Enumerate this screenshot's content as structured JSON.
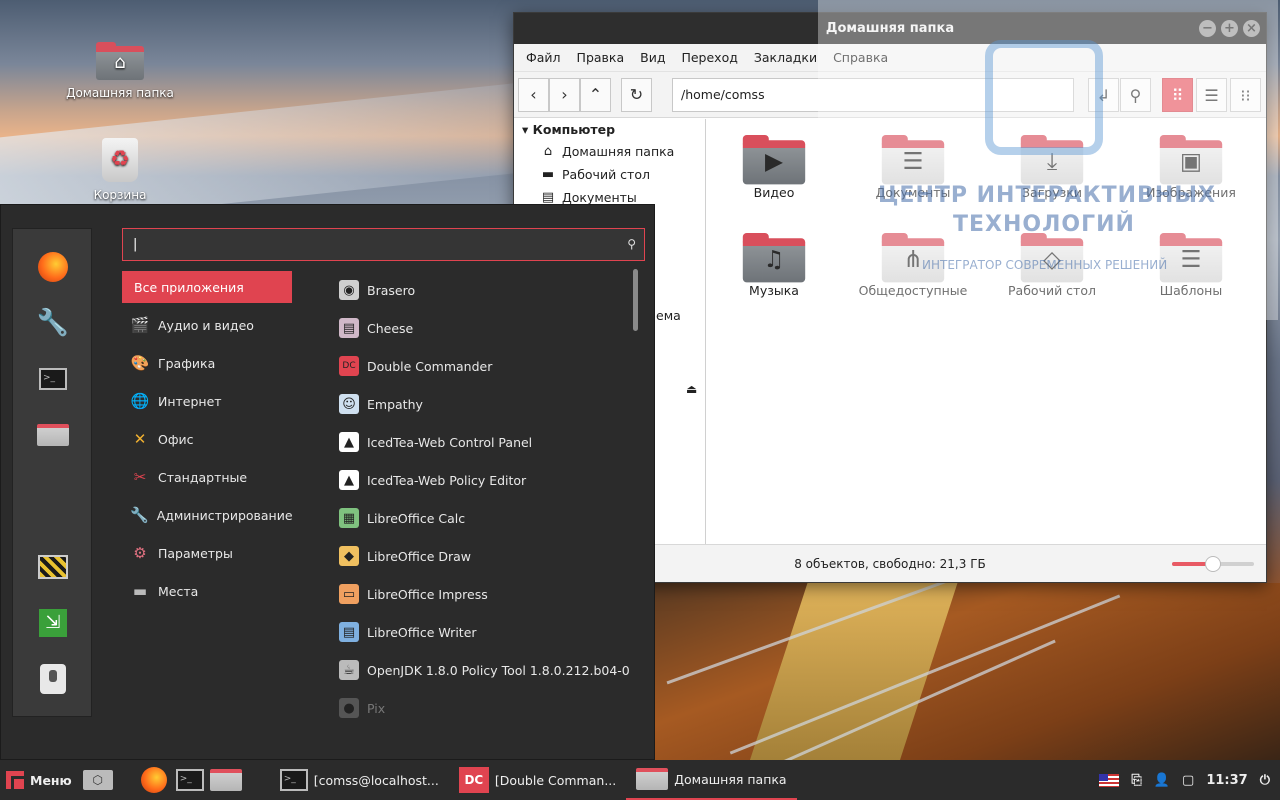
{
  "desktop": {
    "icons": [
      {
        "label": "Домашняя папка"
      },
      {
        "label": "Корзина"
      }
    ]
  },
  "file_manager": {
    "title": "Домашняя папка",
    "menu": [
      "Файл",
      "Правка",
      "Вид",
      "Переход",
      "Закладки",
      "Справка"
    ],
    "path": "/home/comss",
    "sidebar": {
      "header": "Компьютер",
      "items": [
        {
          "label": "Домашняя папка",
          "icon": "home-icon"
        },
        {
          "label": "Рабочий стол",
          "icon": "desktop-icon"
        },
        {
          "label": "Документы",
          "icon": "document-icon"
        }
      ],
      "partial_label": "ема"
    },
    "files": [
      {
        "label": "Видео",
        "glyph": "▶"
      },
      {
        "label": "Документы",
        "glyph": "☰"
      },
      {
        "label": "Загрузки",
        "glyph": "⤓"
      },
      {
        "label": "Изображения",
        "glyph": "▣"
      },
      {
        "label": "Музыка",
        "glyph": "♫"
      },
      {
        "label": "Общедоступные",
        "glyph": "⋔"
      },
      {
        "label": "Рабочий стол",
        "glyph": "◇"
      },
      {
        "label": "Шаблоны",
        "glyph": "☰"
      }
    ],
    "status": "8 объектов, свободно: 21,3 ГБ",
    "zoom_level": 0.5
  },
  "watermark": {
    "line1": "ЦЕНТР ИНТЕРАКТИВНЫХ",
    "line2": "ТЕХНОЛОГИЙ",
    "line3": "ИНТЕГРАТОР СОВРЕМЕННЫХ РЕШЕНИЙ"
  },
  "app_menu": {
    "search_value": "",
    "categories": [
      {
        "label": "Все приложения",
        "icon": ""
      },
      {
        "label": "Аудио и видео",
        "icon": "🎬"
      },
      {
        "label": "Графика",
        "icon": "🎨"
      },
      {
        "label": "Интернет",
        "icon": "🌐"
      },
      {
        "label": "Офис",
        "icon": "✕"
      },
      {
        "label": "Стандартные",
        "icon": "✂"
      },
      {
        "label": "Администрирование",
        "icon": "🔧"
      },
      {
        "label": "Параметры",
        "icon": "⚙"
      },
      {
        "label": "Места",
        "icon": "▬"
      }
    ],
    "apps": [
      {
        "label": "Brasero",
        "icon": "◉",
        "color": "#cfcfcf"
      },
      {
        "label": "Cheese",
        "icon": "▤",
        "color": "#d0b8c8"
      },
      {
        "label": "Double Commander",
        "icon": "DC",
        "color": "#e04450"
      },
      {
        "label": "Empathy",
        "icon": "☺",
        "color": "#cfe0f0"
      },
      {
        "label": "IcedTea-Web Control Panel",
        "icon": "▲",
        "color": "#ffffff"
      },
      {
        "label": "IcedTea-Web Policy Editor",
        "icon": "▲",
        "color": "#ffffff"
      },
      {
        "label": "LibreOffice Calc",
        "icon": "▦",
        "color": "#7fc27f"
      },
      {
        "label": "LibreOffice Draw",
        "icon": "◆",
        "color": "#f0c060"
      },
      {
        "label": "LibreOffice Impress",
        "icon": "▭",
        "color": "#f0a060"
      },
      {
        "label": "LibreOffice Writer",
        "icon": "▤",
        "color": "#7fb0e0"
      },
      {
        "label": "OpenJDK 1.8.0 Policy Tool 1.8.0.212.b04-0...",
        "icon": "☕",
        "color": "#bbbbbb"
      },
      {
        "label": "Pix",
        "icon": "●",
        "color": "#555555"
      }
    ]
  },
  "taskbar": {
    "menu_label": "Меню",
    "windows": [
      {
        "label": "[comss@localhost...",
        "icon": "terminal-icon"
      },
      {
        "label": "[Double Comman...",
        "icon": "double-commander-icon"
      },
      {
        "label": "Домашняя папка",
        "icon": "folder-icon"
      }
    ],
    "time": "11:37"
  },
  "colors": {
    "accent": "#e04450",
    "panel": "#2b2b2b"
  }
}
